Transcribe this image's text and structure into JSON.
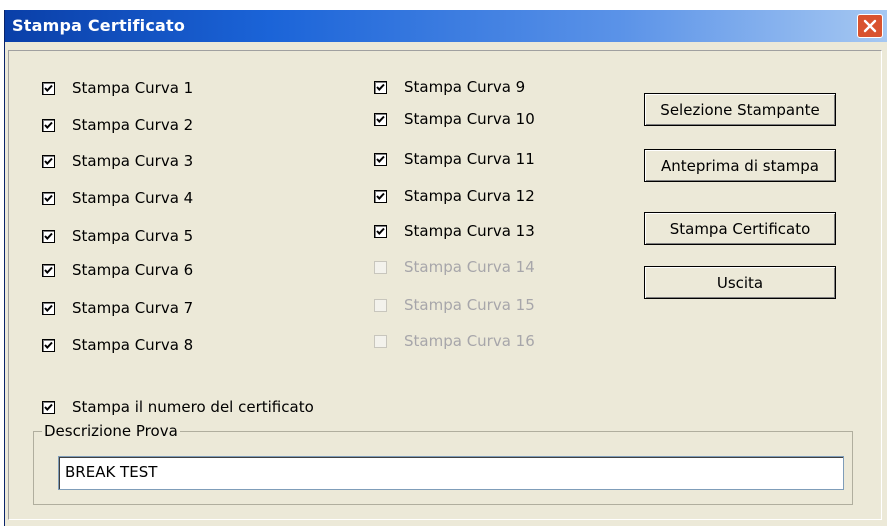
{
  "window": {
    "title": "Stampa Certificato"
  },
  "checkboxes_left": [
    {
      "label": "Stampa Curva 1",
      "checked": true,
      "enabled": true
    },
    {
      "label": "Stampa Curva 2",
      "checked": true,
      "enabled": true
    },
    {
      "label": "Stampa Curva 3",
      "checked": true,
      "enabled": true
    },
    {
      "label": "Stampa Curva 4",
      "checked": true,
      "enabled": true
    },
    {
      "label": "Stampa Curva 5",
      "checked": true,
      "enabled": true
    },
    {
      "label": "Stampa Curva 6",
      "checked": true,
      "enabled": true
    },
    {
      "label": "Stampa Curva 7",
      "checked": true,
      "enabled": true
    },
    {
      "label": "Stampa Curva 8",
      "checked": true,
      "enabled": true
    }
  ],
  "checkboxes_right": [
    {
      "label": "Stampa Curva 9",
      "checked": true,
      "enabled": true
    },
    {
      "label": "Stampa Curva 10",
      "checked": true,
      "enabled": true
    },
    {
      "label": "Stampa Curva 11",
      "checked": true,
      "enabled": true
    },
    {
      "label": "Stampa Curva 12",
      "checked": true,
      "enabled": true
    },
    {
      "label": "Stampa Curva 13",
      "checked": true,
      "enabled": true
    },
    {
      "label": "Stampa Curva 14",
      "checked": false,
      "enabled": false
    },
    {
      "label": "Stampa Curva 15",
      "checked": false,
      "enabled": false
    },
    {
      "label": "Stampa Curva 16",
      "checked": false,
      "enabled": false
    }
  ],
  "certificate_number": {
    "label": "Stampa il numero del certificato",
    "checked": true
  },
  "buttons": {
    "select_printer": "Selezione Stampante",
    "print_preview": "Anteprima di stampa",
    "print_certificate": "Stampa Certificato",
    "exit": "Uscita"
  },
  "description": {
    "legend": "Descrizione Prova",
    "value": "BREAK TEST"
  },
  "colors": {
    "title_start": "#0a3fa8",
    "title_end": "#a6c8f2",
    "close": "#d9532f",
    "face": "#ece9d8",
    "disabled_text": "#a7a6aa"
  }
}
